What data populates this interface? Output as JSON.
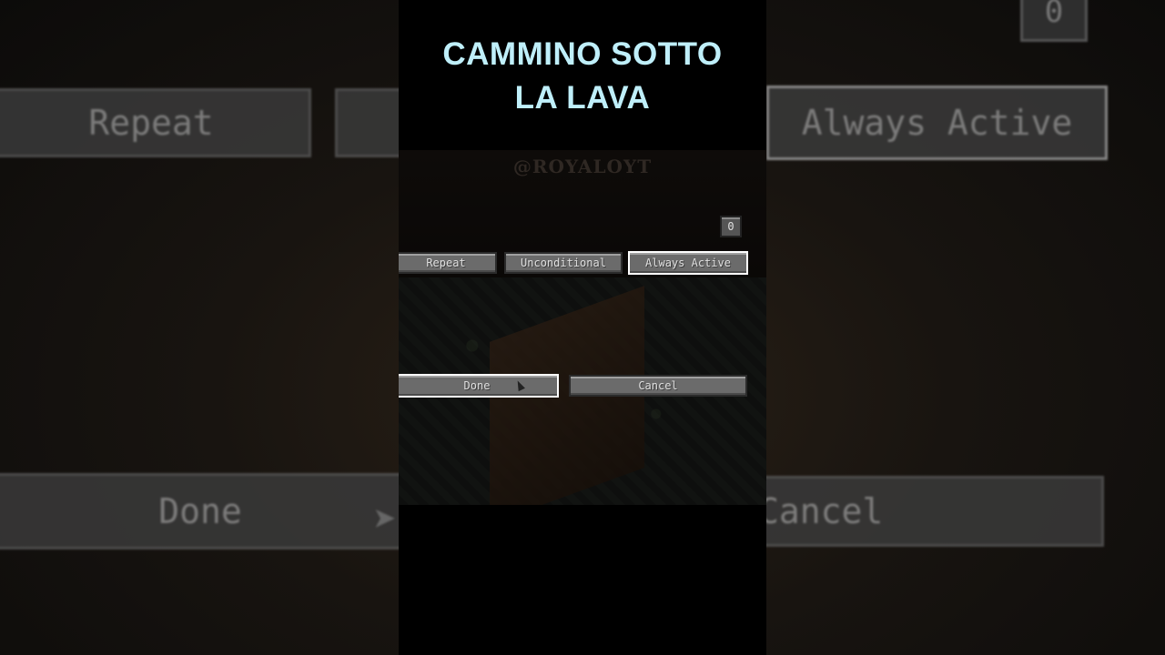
{
  "video": {
    "title_line1": "CAMMINO  SOTTO",
    "title_line2": "LA LAVA",
    "watermark": "@ROYALOYT"
  },
  "command_block_ui": {
    "output_count": "0",
    "mode_button": "Repeat",
    "condition_button": "Unconditional",
    "redstone_button": "Always Active",
    "done_button": "Done",
    "cancel_button": "Cancel"
  },
  "backdrop": {
    "repeat": "Repeat",
    "always_active": "Always Active",
    "done": "Done",
    "cancel": "Cancel",
    "zero": "0"
  },
  "colors": {
    "title": "#bfeffa",
    "button_bg": "#6b6b6b",
    "selected_border": "#ffffff"
  }
}
